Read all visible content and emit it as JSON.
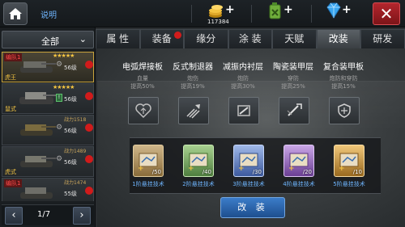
{
  "topbar": {
    "help_label": "说明",
    "resources": [
      {
        "icon": "gold-coins-icon",
        "amount": "117384"
      },
      {
        "icon": "fuel-can-icon",
        "amount": ""
      },
      {
        "icon": "diamond-icon",
        "amount": ""
      }
    ],
    "plus": "+",
    "close_label": "✕"
  },
  "sidebar": {
    "filter_label": "全部",
    "tanks": [
      {
        "team": "编队1",
        "stars": "★★★★★",
        "power": "",
        "level": "56级",
        "name": "虎王",
        "selected": true
      },
      {
        "team": "",
        "stars": "★★★★★",
        "power": "",
        "level": "56级",
        "name": "鼠式",
        "selected": false
      },
      {
        "team": "",
        "stars": "★★★★★",
        "power": "战力1518",
        "level": "56级",
        "name": "",
        "selected": false
      },
      {
        "team": "",
        "stars": "★★★★★",
        "power": "战力1489",
        "level": "56级",
        "name": "虎式",
        "selected": false
      },
      {
        "team": "编队1",
        "stars": "★★★★★",
        "power": "战力1474",
        "level": "55级",
        "name": "",
        "selected": false
      }
    ],
    "pager": {
      "prev": "‹",
      "page": "1/7",
      "next": "›"
    }
  },
  "tabs": [
    {
      "label": "属 性",
      "active": false,
      "dot": false
    },
    {
      "label": "装备",
      "active": false,
      "dot": true
    },
    {
      "label": "缘分",
      "active": false,
      "dot": false
    },
    {
      "label": "涂 装",
      "active": false,
      "dot": false
    },
    {
      "label": "天赋",
      "active": false,
      "dot": false
    },
    {
      "label": "改装",
      "active": true,
      "dot": false
    },
    {
      "label": "研发",
      "active": false,
      "dot": false
    }
  ],
  "modules": [
    {
      "title": "电弧焊接板",
      "attr": "血量",
      "bonus": "提高50%",
      "icon": "heart-icon"
    },
    {
      "title": "反式制退器",
      "attr": "炮伤",
      "bonus": "提高19%",
      "icon": "blast-icon"
    },
    {
      "title": "减振内衬层",
      "attr": "炮防",
      "bonus": "提高30%",
      "icon": "shell-icon"
    },
    {
      "title": "陶瓷装甲层",
      "attr": "穿防",
      "bonus": "提高25%",
      "icon": "pierce-icon"
    },
    {
      "title": "复合装甲板",
      "attr": "炮防和穿防",
      "bonus": "提高15%",
      "icon": "shield-icon"
    }
  ],
  "parts": [
    {
      "count": "/50",
      "label": "1阶悬挂技术",
      "color": "#b79a6a"
    },
    {
      "count": "/40",
      "label": "2阶悬挂技术",
      "color": "#5f9b55"
    },
    {
      "count": "/30",
      "label": "3阶悬挂技术",
      "color": "#5878b8"
    },
    {
      "count": "/20",
      "label": "4阶悬挂技术",
      "color": "#8e5fb4"
    },
    {
      "count": "/10",
      "label": "5阶悬挂技术",
      "color": "#c59136"
    }
  ],
  "modify_label": "改 装"
}
